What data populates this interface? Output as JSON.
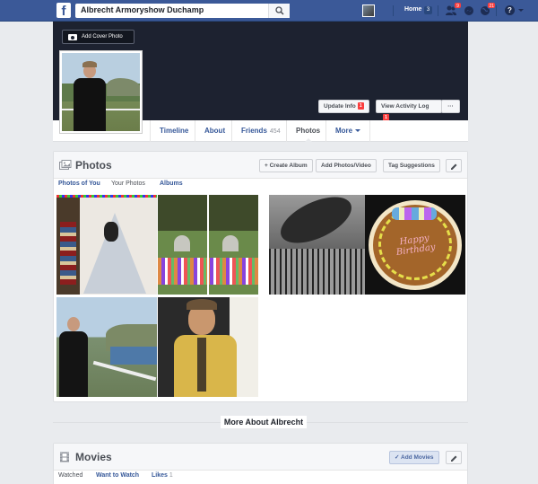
{
  "topbar": {
    "search_value": "Albrecht Armoryshow Duchamp",
    "home_label": "Home",
    "home_count": "3",
    "friend_requests_badge": "9",
    "notifications_badge": "21",
    "help_label": "?",
    "brand_color": "#3b5998"
  },
  "cover": {
    "add_cover_label": "Add Cover Photo",
    "update_info_label": "Update Info",
    "update_info_badge": "1",
    "activity_log_label": "View Activity Log",
    "activity_log_badge": "1",
    "more_dots": "···"
  },
  "profile_tabs": [
    {
      "label": "Timeline"
    },
    {
      "label": "About"
    },
    {
      "label": "Friends",
      "count": "454"
    },
    {
      "label": "Photos"
    },
    {
      "label": "More"
    }
  ],
  "photos": {
    "title": "Photos",
    "create_album": "+ Create Album",
    "add_photos": "Add Photos/Video",
    "tag_suggestions": "Tag Suggestions",
    "subtabs": [
      "Photos of You",
      "Your Photos",
      "Albums"
    ],
    "selected_subtab": "Your Photos",
    "cake_text": "Happy Birthday"
  },
  "more_about": "More About Albrecht",
  "movies": {
    "title": "Movies",
    "add_label": "✓ Add Movies",
    "subtabs": [
      "Watched",
      "Want to Watch",
      "Likes"
    ],
    "likes_count": "1"
  }
}
